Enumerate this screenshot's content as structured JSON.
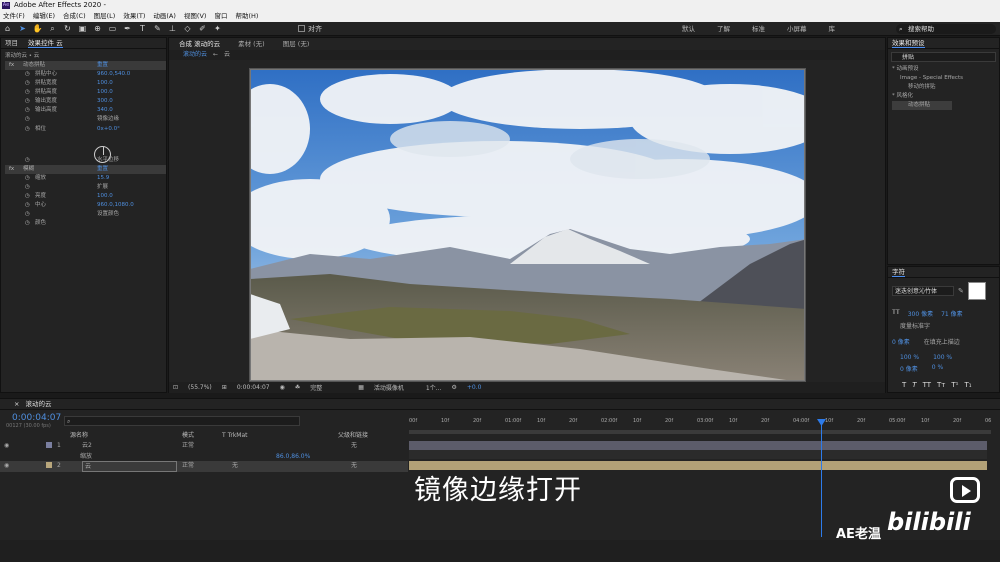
{
  "app": {
    "title": "Adobe After Effects 2020 -"
  },
  "menu": [
    "文件(F)",
    "编辑(E)",
    "合成(C)",
    "图层(L)",
    "效果(T)",
    "动画(A)",
    "视图(V)",
    "窗口",
    "帮助(H)"
  ],
  "toolbar": {
    "align_label": "对齐",
    "workspaces": [
      "默认",
      "了解",
      "标准",
      "小屏幕",
      "库"
    ],
    "search_help": "搜索帮助"
  },
  "left_panel": {
    "tab_project": "项目",
    "tab_effects": "效果控件 云",
    "subtitle": "滚动的云 • 云",
    "rows": [
      {
        "label": "动态拼贴",
        "value": "重置",
        "fx": true
      },
      {
        "label": "拼贴中心",
        "value": "960.0,540.0"
      },
      {
        "label": "拼贴宽度",
        "value": "100.0"
      },
      {
        "label": "拼贴高度",
        "value": "100.0"
      },
      {
        "label": "输出宽度",
        "value": "300.0"
      },
      {
        "label": "输出高度",
        "value": "340.0"
      },
      {
        "label": "",
        "value": "镜像边缘"
      },
      {
        "label": "相位",
        "value": "0x+0.0°"
      },
      {
        "label": "",
        "value": "水平位移"
      },
      {
        "label": "模糊",
        "value": "重置",
        "fx": true
      },
      {
        "label": "缩放",
        "value": "15.9"
      },
      {
        "label": "",
        "value": "扩展"
      },
      {
        "label": "亮度",
        "value": "100.0"
      },
      {
        "label": "中心",
        "value": "960.0,1080.0"
      },
      {
        "label": "",
        "value": "设置颜色"
      },
      {
        "label": "颜色",
        "value": ""
      }
    ]
  },
  "comp": {
    "tabs": [
      "合成 滚动的云",
      "素材 (无)",
      "图层 (无)"
    ],
    "breadcrumb": [
      "滚动的云",
      "云"
    ],
    "footer": {
      "zoom": "(55.7%)",
      "time": "0:00:04:07",
      "quality": "完整",
      "camera": "活动摄像机",
      "views": "1个...",
      "exposure": "+0.0"
    }
  },
  "right_panel": {
    "tab": "效果和预设",
    "search": "拼贴",
    "tree": [
      "* 动画预设",
      "Image - Special Effects",
      "移动的拼贴",
      "* 风格化",
      "动态拼贴"
    ],
    "char_title": "字符",
    "font": "迷迭创意沁竹体",
    "font_size": "300 像素",
    "leading": "71 像素",
    "tracking_label": "度量标准字",
    "kerning": "0",
    "stroke": "0 像素",
    "stroke_mode": "在填充上描边",
    "vscale": "100 %",
    "hscale": "100 %",
    "baseline": "0 像素",
    "tsume": "0 %"
  },
  "timeline": {
    "comp_name": "滚动的云",
    "time": "0:00:04:07",
    "fps_info": "00127 (30.00 fps)",
    "columns": {
      "source": "源名称",
      "mode": "模式",
      "trk": "T TrkMat",
      "parent": "父级和链接"
    },
    "ruler": [
      "00f",
      "10f",
      "20f",
      "01:00f",
      "10f",
      "20f",
      "02:00f",
      "10f",
      "20f",
      "03:00f",
      "10f",
      "20f",
      "04:00f",
      "10f",
      "20f",
      "05:00f",
      "10f",
      "20f",
      "06"
    ],
    "layers": [
      {
        "num": "1",
        "name": "云2",
        "mode": "正常",
        "trk": "",
        "parent": "无",
        "color": "#7a7fa0"
      },
      {
        "num": "",
        "name": "缩放",
        "mode": "",
        "trk": "",
        "parent": "",
        "value": "86.0,86.0%"
      },
      {
        "num": "2",
        "name": "云",
        "mode": "正常",
        "trk": "无",
        "parent": "无",
        "color": "#b9a77c"
      }
    ]
  },
  "caption": "镜像边缘打开",
  "watermark": {
    "logo": "bilibili",
    "author": "AE老温"
  },
  "colors": {
    "accent": "#4f8fdf",
    "cursor": "#2d7bea",
    "layer2_bar": "#b2a177",
    "layer1_bar": "#5c5c6a"
  }
}
